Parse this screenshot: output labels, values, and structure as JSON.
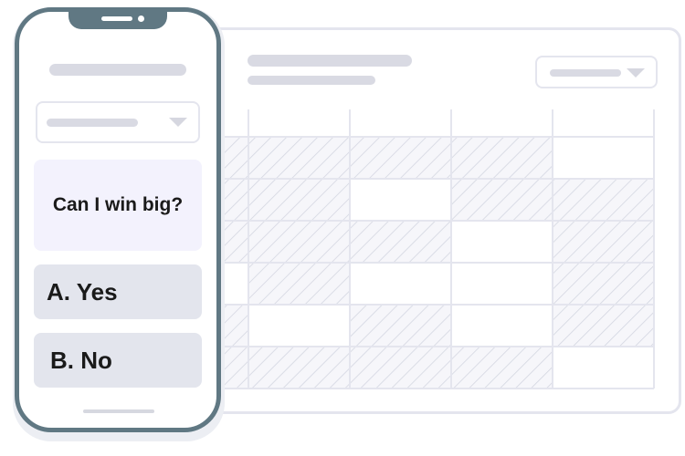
{
  "phone": {
    "question": "Can I win big?",
    "answers": [
      {
        "label": "A. Yes"
      },
      {
        "label": "B. No"
      }
    ]
  },
  "colors": {
    "phone_frame": "#607883",
    "card_border": "#e4e5ee",
    "placeholder": "#d9dae3",
    "question_bg": "#f3f2fd",
    "answer_bg": "#e3e5ed",
    "hatch": "#d4d6e1"
  },
  "icons": {
    "dropdown": "chevron-down-icon"
  },
  "table": {
    "rows": 6,
    "cols": 5,
    "hatched": [
      [
        true,
        true,
        true,
        true,
        false
      ],
      [
        true,
        true,
        false,
        true,
        true
      ],
      [
        true,
        true,
        true,
        false,
        true
      ],
      [
        false,
        true,
        false,
        false,
        true
      ],
      [
        true,
        false,
        true,
        false,
        true
      ],
      [
        true,
        true,
        true,
        true,
        false
      ]
    ]
  }
}
